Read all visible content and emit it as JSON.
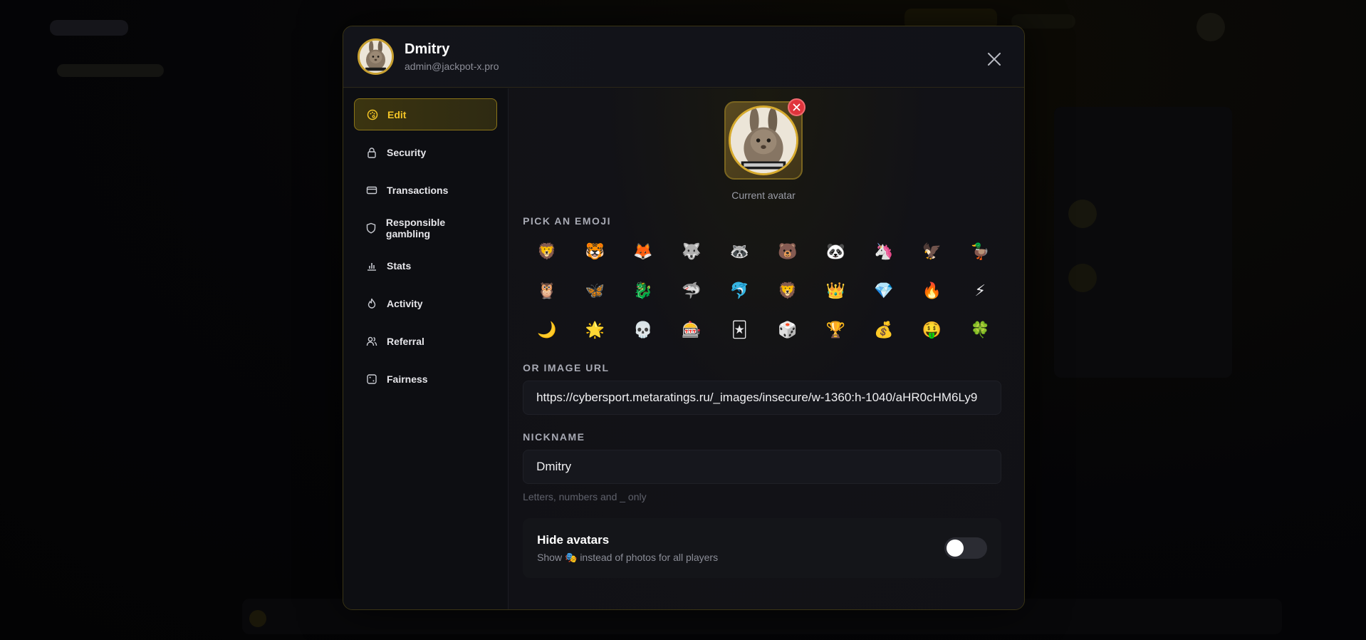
{
  "header": {
    "name": "Dmitry",
    "email": "admin@jackpot-x.pro",
    "close_icon": "close-icon"
  },
  "sidebar": {
    "items": [
      {
        "label": "Edit",
        "icon": "palette-icon",
        "active": true
      },
      {
        "label": "Security",
        "icon": "lock-icon",
        "active": false
      },
      {
        "label": "Transactions",
        "icon": "credit-card-icon",
        "active": false
      },
      {
        "label": "Responsible gambling",
        "icon": "shield-icon",
        "active": false
      },
      {
        "label": "Stats",
        "icon": "bar-chart-icon",
        "active": false
      },
      {
        "label": "Activity",
        "icon": "flame-icon",
        "active": false
      },
      {
        "label": "Referral",
        "icon": "users-icon",
        "active": false
      },
      {
        "label": "Fairness",
        "icon": "dice-icon",
        "active": false
      }
    ]
  },
  "avatar": {
    "caption": "Current avatar",
    "remove_icon": "remove-icon"
  },
  "emoji_section": {
    "label": "PICK AN EMOJI",
    "emojis": [
      "🦁",
      "🐯",
      "🦊",
      "🐺",
      "🦝",
      "🐻",
      "🐼",
      "🦄",
      "🦅",
      "🦆",
      "🦉",
      "🦋",
      "🐉",
      "🦈",
      "🐬",
      "🦁",
      "👑",
      "💎",
      "🔥",
      "⚡",
      "🌙",
      "🌟",
      "💀",
      "🎰",
      "🃏",
      "🎲",
      "🏆",
      "💰",
      "🤑",
      "🍀"
    ]
  },
  "image_url": {
    "label": "OR IMAGE URL",
    "value": "https://cybersport.metaratings.ru/_images/insecure/w-1360:h-1040/aHR0cHM6Ly9"
  },
  "nickname": {
    "label": "NICKNAME",
    "value": "Dmitry",
    "hint": "Letters, numbers and _ only"
  },
  "hide_avatars": {
    "title": "Hide avatars",
    "subtitle_prefix": "Show",
    "subtitle_emoji": "🎭",
    "subtitle_suffix": "instead of photos for all players",
    "enabled": false
  },
  "colors": {
    "accent": "#f3c526",
    "modal_border": "#3a3415",
    "danger": "#e0343c"
  }
}
